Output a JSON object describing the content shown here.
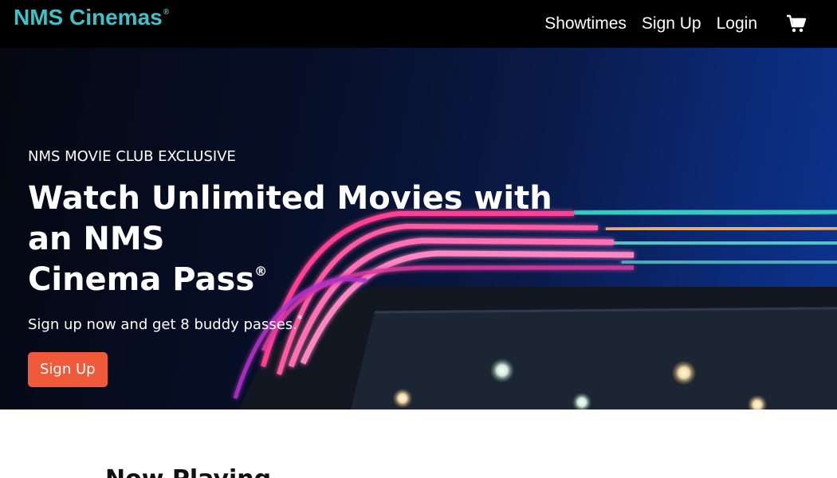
{
  "brand": {
    "name": "NMS Cinemas",
    "mark": "®",
    "color": "#3ec2c7"
  },
  "nav": {
    "items": [
      {
        "label": "Showtimes"
      },
      {
        "label": "Sign Up"
      },
      {
        "label": "Login"
      }
    ],
    "cart_icon": "shopping-cart-icon"
  },
  "hero": {
    "eyebrow": "NMS MOVIE CLUB EXCLUSIVE",
    "headline_line1": "Watch Unlimited Movies with an NMS",
    "headline_line2": "Cinema Pass",
    "headline_mark": "®",
    "subline": "Sign up now and get 8 buddy passes.",
    "subline_mark": "*",
    "cta_label": "Sign Up",
    "cta_color": "#ee5a3a"
  },
  "next_section": {
    "heading": "Now Playing"
  }
}
